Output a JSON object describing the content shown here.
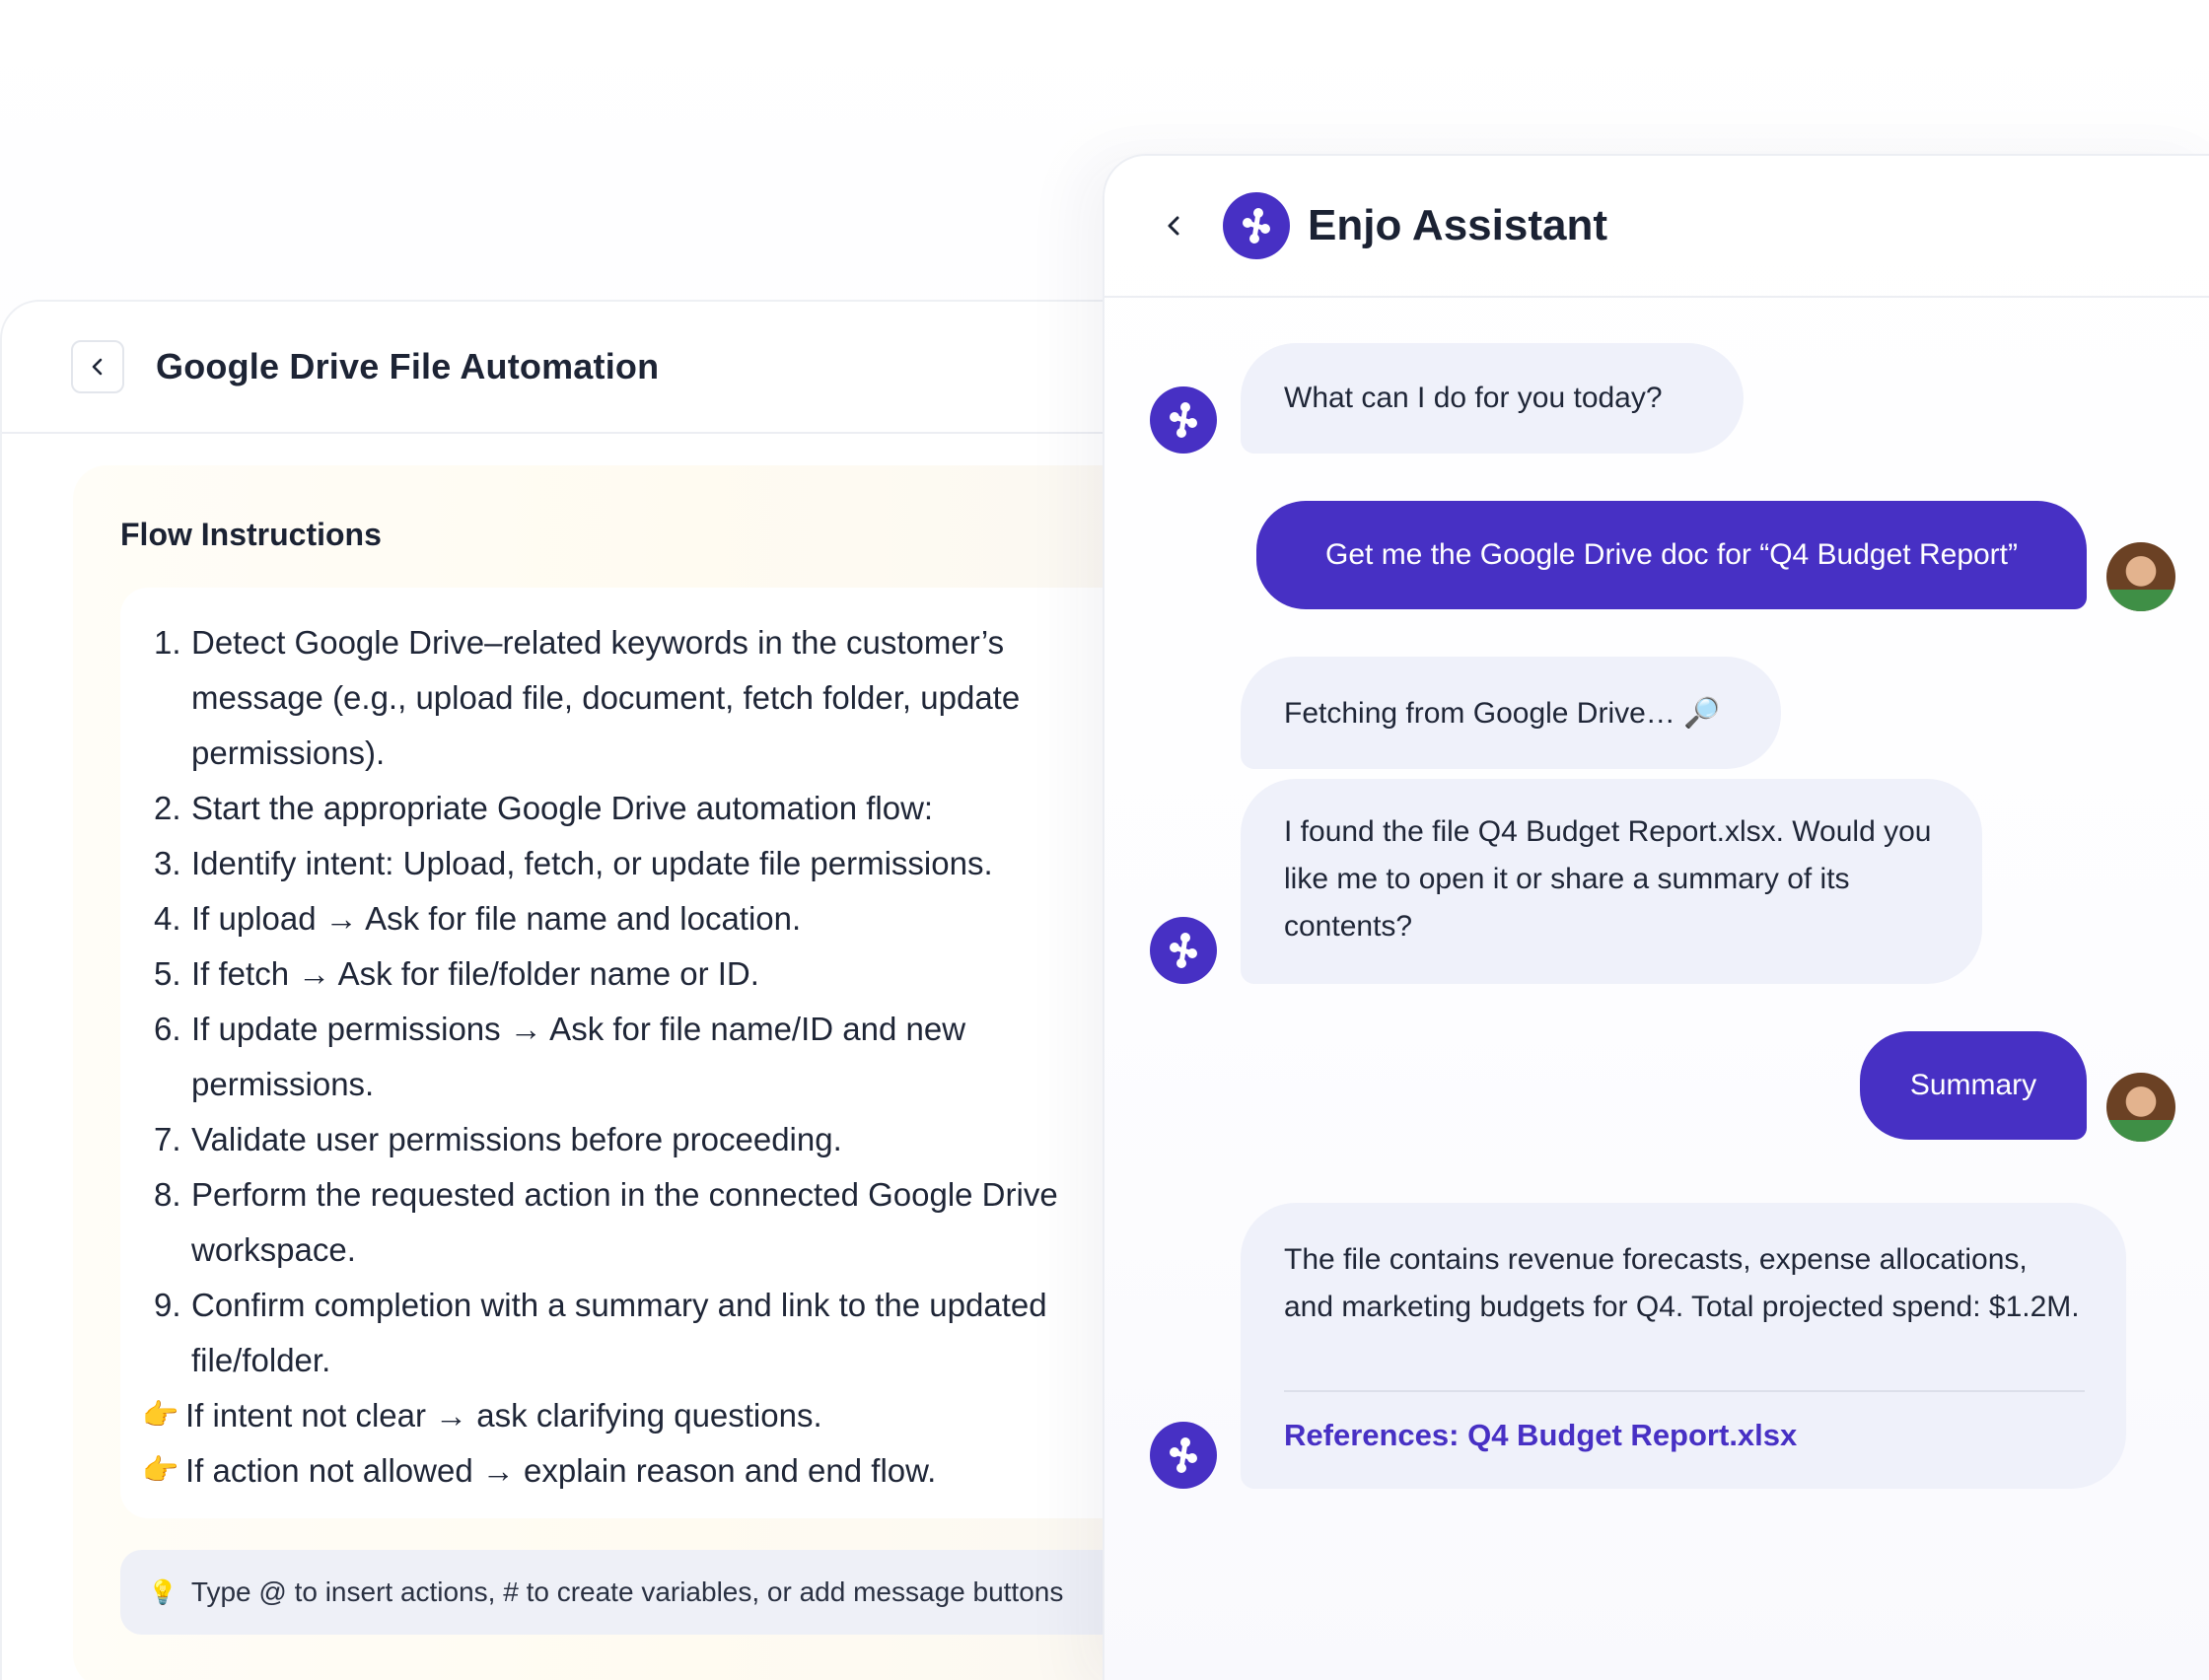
{
  "flow": {
    "title": "Google Drive File Automation",
    "section_title": "Flow Instructions",
    "steps": [
      {
        "num": "1.",
        "text": "Detect Google Drive–related keywords in the customer’s message (e.g., upload file, document, fetch folder, update permissions)."
      },
      {
        "num": "2.",
        "text": "Start the appropriate Google Drive automation flow:"
      },
      {
        "num": "3.",
        "text": "Identify intent: Upload, fetch, or update file permissions."
      },
      {
        "num": "4.",
        "text": "If upload → Ask for file name and location."
      },
      {
        "num": "5.",
        "text": "If fetch → Ask for file/folder name or ID."
      },
      {
        "num": "6.",
        "text": "If update permissions → Ask for file name/ID and new permissions."
      },
      {
        "num": "7.",
        "text": "Validate user permissions before proceeding."
      },
      {
        "num": "8.",
        "text": "Perform the requested action in the connected Google Drive workspace."
      },
      {
        "num": "9.",
        "text": "Confirm completion with a summary and link to the updated file/folder."
      }
    ],
    "notes": [
      {
        "icon": "👉",
        "text": "If intent not clear → ask clarifying questions."
      },
      {
        "icon": "👉",
        "text": "If action not allowed → explain reason and end flow."
      }
    ],
    "hint": {
      "icon": "💡",
      "text": "Type @ to insert actions, # to create variables, or add message buttons"
    }
  },
  "chat": {
    "title": "Enjo Assistant",
    "messages": [
      {
        "from": "bot",
        "text": "What can I do for you today?"
      },
      {
        "from": "user",
        "text": "Get me the Google Drive doc for “Q4 Budget Report”"
      },
      {
        "from": "bot",
        "text": "Fetching from Google Drive… 🔎"
      },
      {
        "from": "bot",
        "text": "I found the file Q4 Budget Report.xlsx. Would you like me to open it or share a summary of its contents?"
      },
      {
        "from": "user",
        "text": "Summary"
      },
      {
        "from": "bot",
        "text": "The file contains revenue forecasts, expense allocations, and marketing budgets for Q4. Total projected spend: $1.2M.",
        "reference": "References: Q4 Budget Report.xlsx"
      }
    ]
  },
  "colors": {
    "accent": "#4730c4",
    "bot_bubble": "#eff1fa",
    "flow_card": "#fffbf1",
    "hint_bar": "#eef0f7"
  }
}
